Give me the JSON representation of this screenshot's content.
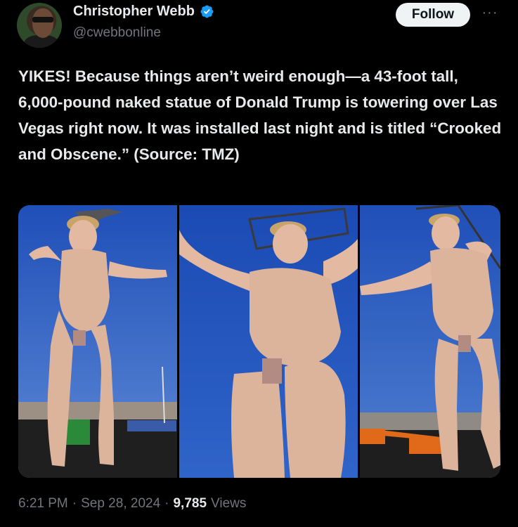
{
  "author": {
    "display_name": "Christopher Webb",
    "handle": "@cwebbonline",
    "verified": true,
    "verified_color": "#1d9bf0"
  },
  "actions": {
    "follow_label": "Follow",
    "more_label": "···"
  },
  "tweet": {
    "text": "YIKES! Because things aren’t weird enough—a 43-foot tall, 6,000-pound naked statue of Donald Trump is towering over Las Vegas right now. It was installed last night and is titled “Crooked and Obscene.” (Source: TMZ)",
    "media": [
      {
        "kind": "photo"
      },
      {
        "kind": "photo"
      },
      {
        "kind": "photo"
      }
    ]
  },
  "meta": {
    "time": "6:21 PM",
    "separator": "·",
    "date": "Sep 28, 2024",
    "views_count": "9,785",
    "views_label": "Views"
  },
  "colors": {
    "background": "#000000",
    "text_primary": "#e7e9ea",
    "text_secondary": "#71767b",
    "button_bg": "#eff3f4"
  }
}
